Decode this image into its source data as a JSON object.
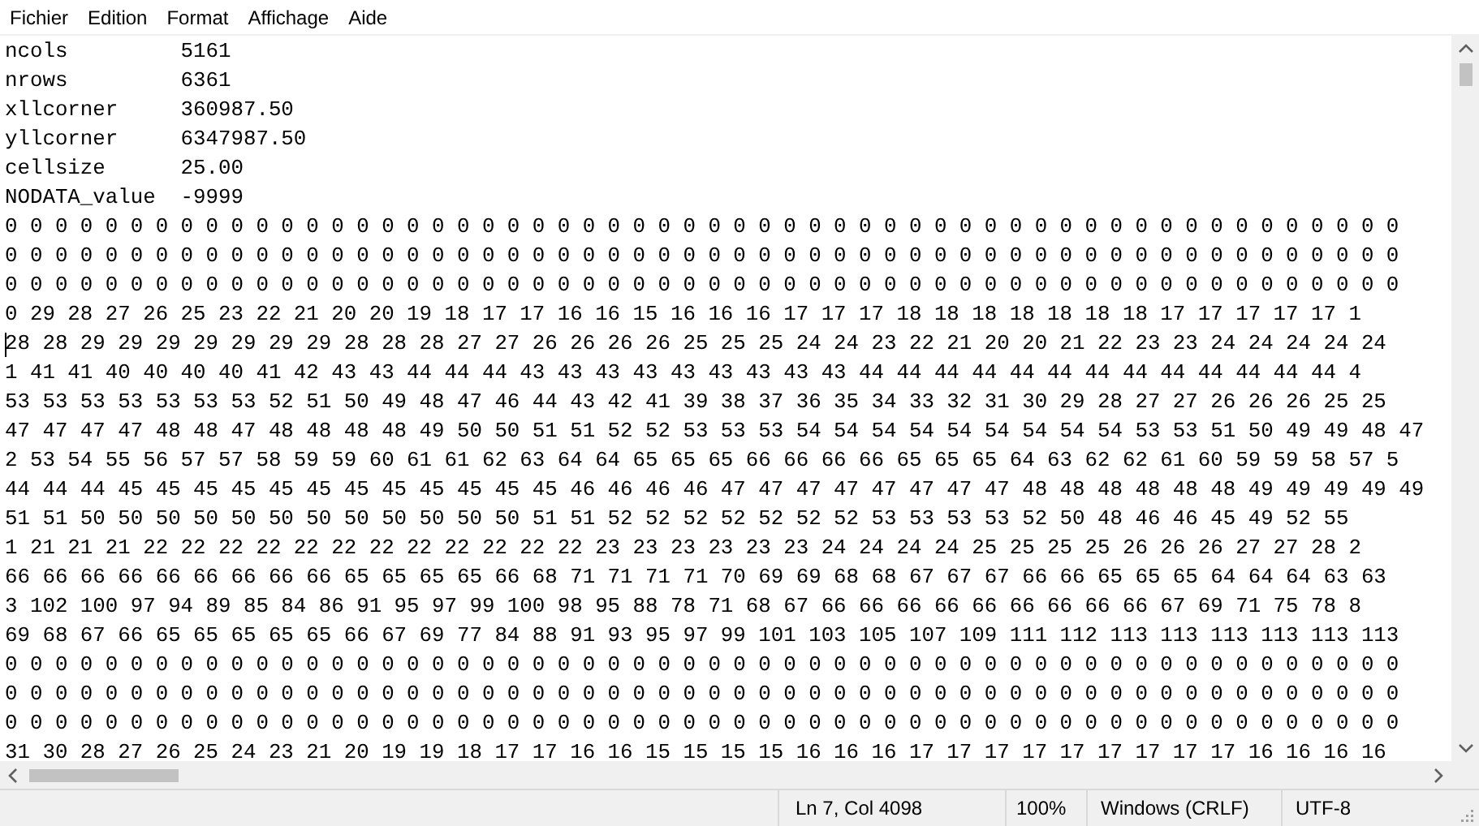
{
  "menu": [
    "Fichier",
    "Edition",
    "Format",
    "Affichage",
    "Aide"
  ],
  "editor": {
    "lines": [
      {
        "text": "ncols         5161",
        "caret": false
      },
      {
        "text": "nrows         6361",
        "caret": false
      },
      {
        "text": "xllcorner     360987.50",
        "caret": false
      },
      {
        "text": "yllcorner     6347987.50",
        "caret": false
      },
      {
        "text": "cellsize      25.00",
        "caret": false
      },
      {
        "text": "NODATA_value  -9999",
        "caret": false
      },
      {
        "text": "0 0 0 0 0 0 0 0 0 0 0 0 0 0 0 0 0 0 0 0 0 0 0 0 0 0 0 0 0 0 0 0 0 0 0 0 0 0 0 0 0 0 0 0 0 0 0 0 0 0 0 0 0 0 0 0",
        "caret": false
      },
      {
        "text": "0 0 0 0 0 0 0 0 0 0 0 0 0 0 0 0 0 0 0 0 0 0 0 0 0 0 0 0 0 0 0 0 0 0 0 0 0 0 0 0 0 0 0 0 0 0 0 0 0 0 0 0 0 0 0 0",
        "caret": false
      },
      {
        "text": "0 0 0 0 0 0 0 0 0 0 0 0 0 0 0 0 0 0 0 0 0 0 0 0 0 0 0 0 0 0 0 0 0 0 0 0 0 0 0 0 0 0 0 0 0 0 0 0 0 0 0 0 0 0 0 0",
        "caret": false
      },
      {
        "text": "0 29 28 27 26 25 23 22 21 20 20 19 18 17 17 16 16 15 16 16 16 17 17 17 18 18 18 18 18 18 18 17 17 17 17 17 1",
        "caret": false
      },
      {
        "text": "28 28 29 29 29 29 29 29 29 28 28 28 27 27 26 26 26 26 25 25 25 24 24 23 22 21 20 20 21 22 23 23 24 24 24 24 24",
        "caret": true
      },
      {
        "text": "1 41 41 40 40 40 40 41 42 43 43 44 44 44 43 43 43 43 43 43 43 43 43 44 44 44 44 44 44 44 44 44 44 44 44 44 4",
        "caret": false
      },
      {
        "text": "53 53 53 53 53 53 53 52 51 50 49 48 47 46 44 43 42 41 39 38 37 36 35 34 33 32 31 30 29 28 27 27 26 26 26 25 25",
        "caret": false
      },
      {
        "text": "47 47 47 47 48 48 47 48 48 48 48 49 50 50 51 51 52 52 53 53 53 54 54 54 54 54 54 54 54 54 53 53 51 50 49 49 48 47",
        "caret": false
      },
      {
        "text": "2 53 54 55 56 57 57 58 59 59 60 61 61 62 63 64 64 65 65 65 66 66 66 66 65 65 65 64 63 62 62 61 60 59 59 58 57 5",
        "caret": false
      },
      {
        "text": "44 44 44 45 45 45 45 45 45 45 45 45 45 45 45 46 46 46 46 47 47 47 47 47 47 47 47 48 48 48 48 48 48 49 49 49 49 49",
        "caret": false
      },
      {
        "text": "51 51 50 50 50 50 50 50 50 50 50 50 50 50 51 51 52 52 52 52 52 52 52 53 53 53 53 52 50 48 46 46 45 49 52 55",
        "caret": false
      },
      {
        "text": "1 21 21 21 22 22 22 22 22 22 22 22 22 22 22 22 23 23 23 23 23 23 24 24 24 24 25 25 25 25 26 26 26 27 27 28 2",
        "caret": false
      },
      {
        "text": "66 66 66 66 66 66 66 66 66 65 65 65 65 66 68 71 71 71 71 70 69 69 68 68 67 67 67 66 66 65 65 65 64 64 64 63 63",
        "caret": false
      },
      {
        "text": "3 102 100 97 94 89 85 84 86 91 95 97 99 100 98 95 88 78 71 68 67 66 66 66 66 66 66 66 66 66 67 69 71 75 78 8",
        "caret": false
      },
      {
        "text": "69 68 67 66 65 65 65 65 65 66 67 69 77 84 88 91 93 95 97 99 101 103 105 107 109 111 112 113 113 113 113 113 113",
        "caret": false
      },
      {
        "text": "0 0 0 0 0 0 0 0 0 0 0 0 0 0 0 0 0 0 0 0 0 0 0 0 0 0 0 0 0 0 0 0 0 0 0 0 0 0 0 0 0 0 0 0 0 0 0 0 0 0 0 0 0 0 0 0",
        "caret": false
      },
      {
        "text": "0 0 0 0 0 0 0 0 0 0 0 0 0 0 0 0 0 0 0 0 0 0 0 0 0 0 0 0 0 0 0 0 0 0 0 0 0 0 0 0 0 0 0 0 0 0 0 0 0 0 0 0 0 0 0 0",
        "caret": false
      },
      {
        "text": "0 0 0 0 0 0 0 0 0 0 0 0 0 0 0 0 0 0 0 0 0 0 0 0 0 0 0 0 0 0 0 0 0 0 0 0 0 0 0 0 0 0 0 0 0 0 0 0 0 0 0 0 0 0 0 0",
        "caret": false
      },
      {
        "text": "31 30 28 27 26 25 24 23 21 20 19 19 18 17 17 16 16 15 15 15 15 16 16 16 17 17 17 17 17 17 17 17 17 16 16 16 16",
        "caret": false
      }
    ]
  },
  "status_bar": {
    "position": "Ln 7, Col 4098",
    "zoom": "100%",
    "line_ending": "Windows (CRLF)",
    "encoding": "UTF-8"
  }
}
